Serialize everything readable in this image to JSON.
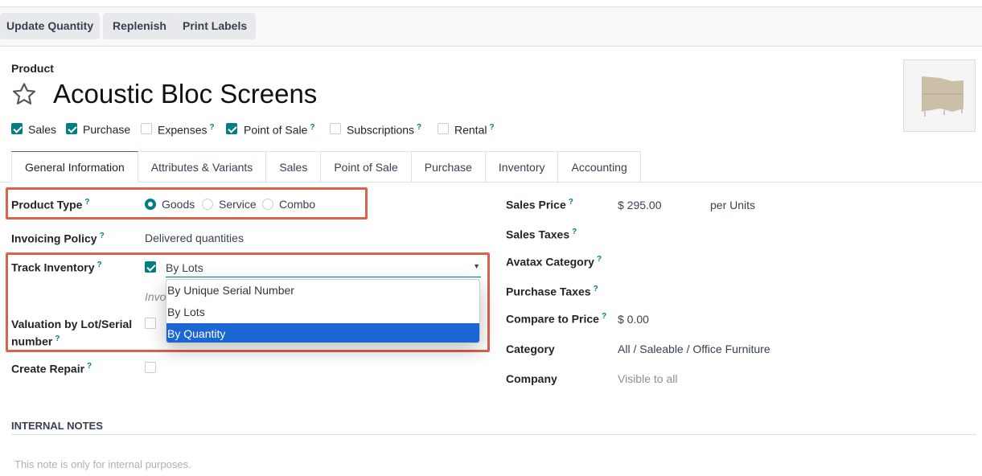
{
  "toolbar": {
    "buttons": [
      "Update Quantity",
      "Replenish",
      "Print Labels"
    ]
  },
  "header": {
    "breadcrumb": "Product",
    "title": "Acoustic Bloc Screens",
    "favorite_icon": "star-outline-icon"
  },
  "options": [
    {
      "label": "Sales",
      "checked": true,
      "help": false
    },
    {
      "label": "Purchase",
      "checked": true,
      "help": false
    },
    {
      "label": "Expenses",
      "checked": false,
      "help": true
    },
    {
      "label": "Point of Sale",
      "checked": true,
      "help": true
    },
    {
      "label": "Subscriptions",
      "checked": false,
      "help": true
    },
    {
      "label": "Rental",
      "checked": false,
      "help": true
    }
  ],
  "help_mark": "?",
  "tabs": [
    "General Information",
    "Attributes & Variants",
    "Sales",
    "Point of Sale",
    "Purchase",
    "Inventory",
    "Accounting"
  ],
  "active_tab": "General Information",
  "left": {
    "product_type": {
      "label": "Product Type",
      "options": [
        "Goods",
        "Service",
        "Combo"
      ],
      "selected": "Goods"
    },
    "invoicing_policy": {
      "label": "Invoicing Policy",
      "value": "Delivered quantities"
    },
    "track_inventory": {
      "label": "Track Inventory",
      "checked": true,
      "value": "By Lots",
      "options": [
        "By Unique Serial Number",
        "By Lots",
        "By Quantity"
      ],
      "highlighted": "By Quantity",
      "hidden_text": "Invo"
    },
    "valuation": {
      "label": "Valuation by Lot/Serial",
      "label2": "number",
      "checked": false
    },
    "create_repair": {
      "label": "Create Repair",
      "checked": false
    }
  },
  "right": {
    "sales_price": {
      "label": "Sales Price",
      "value": "$ 295.00",
      "unit": "per Units"
    },
    "sales_taxes": {
      "label": "Sales Taxes"
    },
    "avatax_category": {
      "label": "Avatax Category"
    },
    "purchase_taxes": {
      "label": "Purchase Taxes"
    },
    "compare_price": {
      "label": "Compare to Price",
      "value": "$ 0.00"
    },
    "category": {
      "label": "Category",
      "value": "All / Saleable / Office Furniture"
    },
    "company": {
      "label": "Company",
      "placeholder": "Visible to all"
    }
  },
  "notes": {
    "heading": "INTERNAL NOTES",
    "placeholder": "This note is only for internal purposes."
  },
  "colors": {
    "accent": "#017e84",
    "highlight": "#d9644a",
    "selected_option": "#1a66d3"
  }
}
